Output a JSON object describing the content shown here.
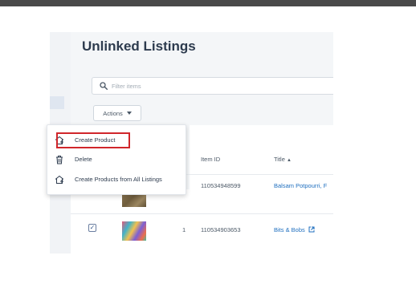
{
  "page": {
    "title": "Unlinked Listings"
  },
  "filter": {
    "placeholder": "Filter items"
  },
  "actions": {
    "label": "Actions",
    "menu": [
      {
        "label": "Create Product",
        "icon": "create-product-icon",
        "highlighted": true
      },
      {
        "label": "Delete",
        "icon": "trash-icon"
      },
      {
        "label": "Create Products from All Listings",
        "icon": "create-product-icon"
      }
    ]
  },
  "table": {
    "headers": {
      "item_id": "Item ID",
      "title": "Title",
      "title_sort": "▲"
    },
    "rows": [
      {
        "item_id": "110534948599",
        "title": "Balsam Potpourri, F",
        "checked": false,
        "thumb_icon": "balsam-thumbnail"
      },
      {
        "qty": "1",
        "item_id": "110534903653",
        "title": "Bits & Bobs",
        "checked": true,
        "thumb_icon": "bits-bobs-thumbnail",
        "link_icon": "external-link-icon"
      }
    ]
  },
  "colors": {
    "highlight": "#d0262b",
    "link": "#1f6fbf",
    "title": "#2d3b4e"
  }
}
